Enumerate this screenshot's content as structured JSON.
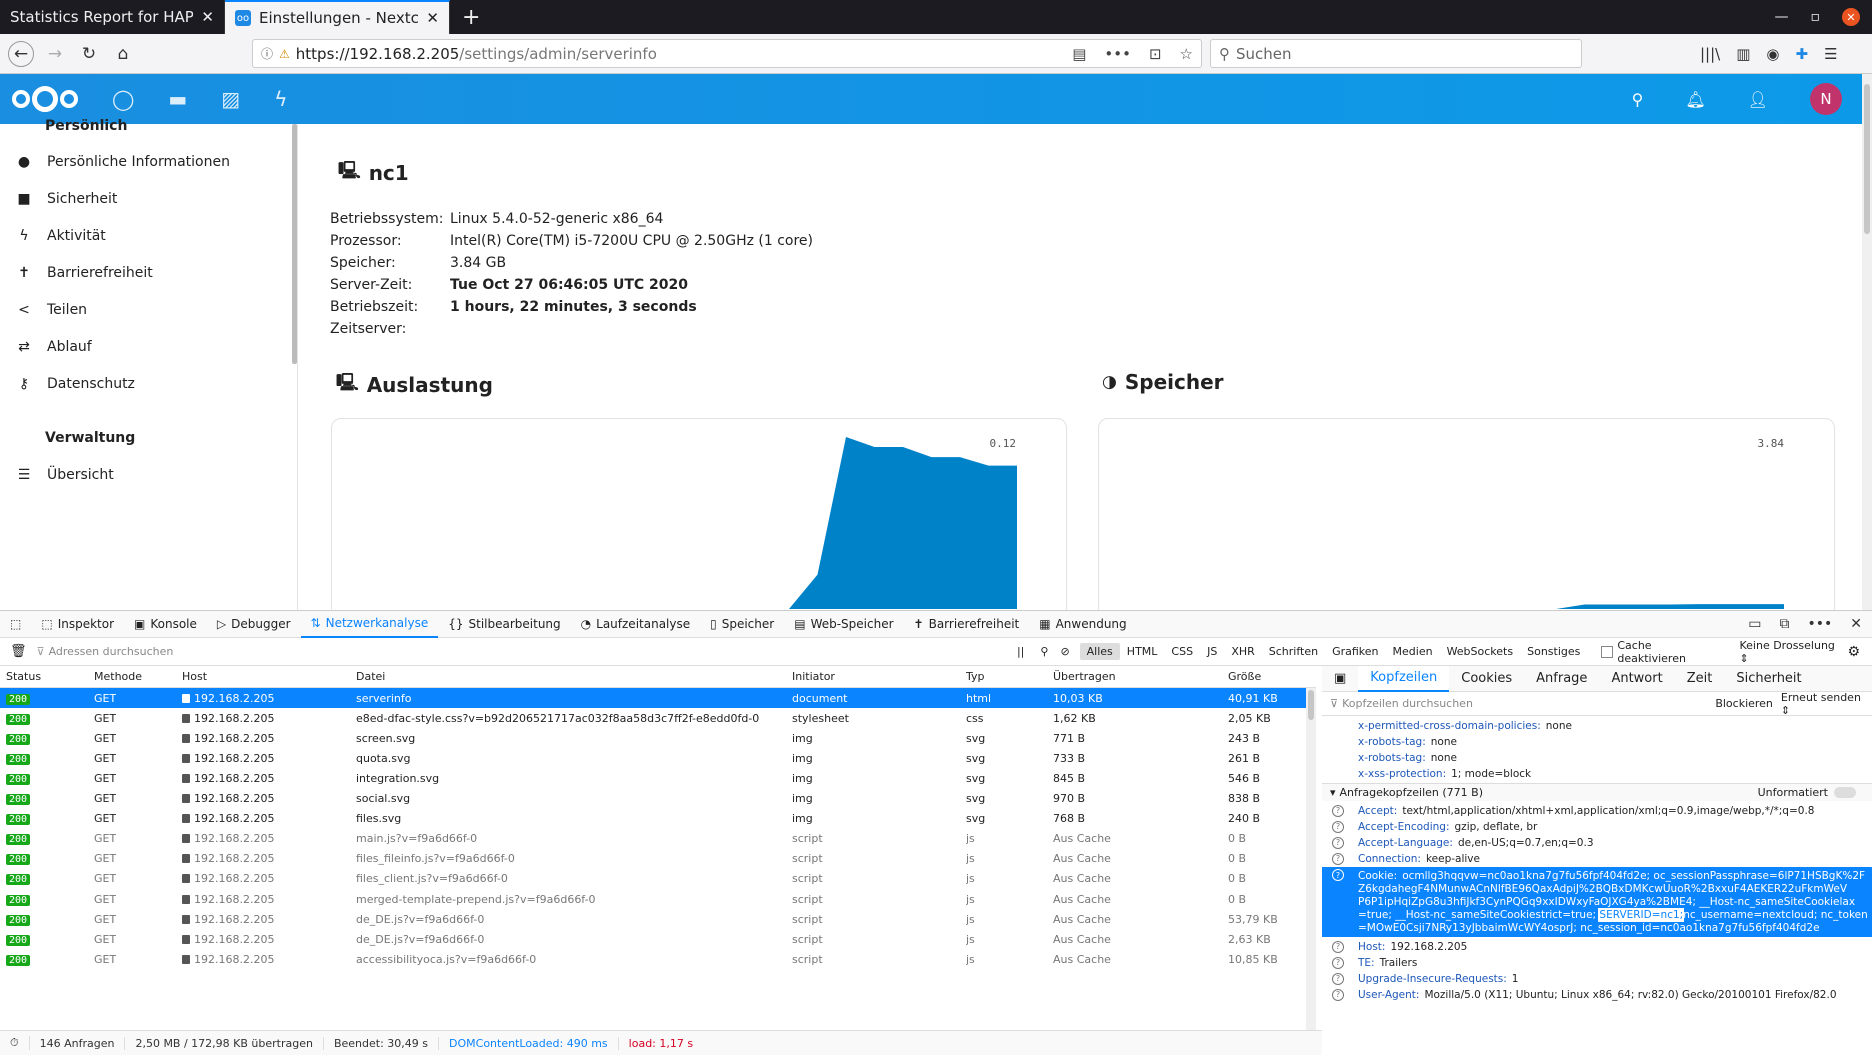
{
  "browser": {
    "tabs": [
      {
        "title": "Statistics Report for HAProx",
        "active": false
      },
      {
        "title": "Einstellungen - Nextclou",
        "active": true
      }
    ],
    "url_host": "https://192.168.2.205",
    "url_path": "/settings/admin/serverinfo",
    "search_placeholder": "Suchen"
  },
  "nextcloud": {
    "avatar_letter": "N",
    "brand_color": "#0082c9"
  },
  "sidebar": {
    "heading_personal": "Persönlich",
    "items": [
      "Persönliche Informationen",
      "Sicherheit",
      "Aktivität",
      "Barrierefreiheit",
      "Teilen",
      "Ablauf",
      "Datenschutz"
    ],
    "heading_admin": "Verwaltung",
    "admin_items": [
      "Übersicht"
    ]
  },
  "server": {
    "name": "nc1",
    "rows": [
      {
        "k": "Betriebssystem:",
        "v": "Linux 5.4.0-52-generic x86_64",
        "bold": false
      },
      {
        "k": "Prozessor:",
        "v": "Intel(R) Core(TM) i5-7200U CPU @ 2.50GHz (1 core)",
        "bold": false
      },
      {
        "k": "Speicher:",
        "v": "3.84 GB",
        "bold": false
      },
      {
        "k": "Server-Zeit:",
        "v": "Tue Oct 27 06:46:05 UTC 2020",
        "bold": true
      },
      {
        "k": "Betriebszeit:",
        "v": "1 hours, 22 minutes, 3 seconds",
        "bold": true
      },
      {
        "k": "Zeitserver:",
        "v": "",
        "bold": false
      }
    ],
    "load_title": "Auslastung",
    "mem_title": "Speicher",
    "load_max": "0.12",
    "mem_max": "3.84"
  },
  "chart_data": [
    {
      "type": "area",
      "title": "Auslastung",
      "max_label": "0.12",
      "series": [
        {
          "values": [
            0,
            0,
            0,
            0.024,
            0.12,
            0.113,
            0.113,
            0.106,
            0.106,
            0.1,
            0.1
          ]
        }
      ]
    },
    {
      "type": "area",
      "title": "Speicher",
      "max_label": "3.84",
      "series": [
        {
          "values": [
            0,
            0,
            0,
            0.1,
            0.1,
            0.1,
            0.1,
            0.11,
            0.11,
            0.11,
            0.11
          ]
        }
      ]
    }
  ],
  "devtools": {
    "tabs": [
      "Inspektor",
      "Konsole",
      "Debugger",
      "Netzwerkanalyse",
      "Stilbearbeitung",
      "Laufzeitanalyse",
      "Speicher",
      "Web-Speicher",
      "Barrierefreiheit",
      "Anwendung"
    ],
    "active_tab": "Netzwerkanalyse",
    "filter_placeholder": "Adressen durchsuchen",
    "type_filters": [
      "Alles",
      "HTML",
      "CSS",
      "JS",
      "XHR",
      "Schriften",
      "Grafiken",
      "Medien",
      "WebSockets",
      "Sonstiges"
    ],
    "cache_label": "Cache deaktivieren",
    "throttle": "Keine Drosselung ⇕",
    "columns": [
      "Status",
      "Methode",
      "Host",
      "Datei",
      "Initiator",
      "Typ",
      "Übertragen",
      "Größe"
    ],
    "requests": [
      [
        "200",
        "GET",
        "192.168.2.205",
        "serverinfo",
        "document",
        "html",
        "10,03 KB",
        "40,91 KB"
      ],
      [
        "200",
        "GET",
        "192.168.2.205",
        "e8ed-dfac-style.css?v=b92d206521717ac032f8aa58d3c7ff2f-e8edd0fd-0",
        "stylesheet",
        "css",
        "1,62 KB",
        "2,05 KB"
      ],
      [
        "200",
        "GET",
        "192.168.2.205",
        "screen.svg",
        "img",
        "svg",
        "771 B",
        "243 B"
      ],
      [
        "200",
        "GET",
        "192.168.2.205",
        "quota.svg",
        "img",
        "svg",
        "733 B",
        "261 B"
      ],
      [
        "200",
        "GET",
        "192.168.2.205",
        "integration.svg",
        "img",
        "svg",
        "845 B",
        "546 B"
      ],
      [
        "200",
        "GET",
        "192.168.2.205",
        "social.svg",
        "img",
        "svg",
        "970 B",
        "838 B"
      ],
      [
        "200",
        "GET",
        "192.168.2.205",
        "files.svg",
        "img",
        "svg",
        "768 B",
        "240 B"
      ],
      [
        "200",
        "GET",
        "192.168.2.205",
        "main.js?v=f9a6d66f-0",
        "script",
        "js",
        "Aus Cache",
        "0 B"
      ],
      [
        "200",
        "GET",
        "192.168.2.205",
        "files_fileinfo.js?v=f9a6d66f-0",
        "script",
        "js",
        "Aus Cache",
        "0 B"
      ],
      [
        "200",
        "GET",
        "192.168.2.205",
        "files_client.js?v=f9a6d66f-0",
        "script",
        "js",
        "Aus Cache",
        "0 B"
      ],
      [
        "200",
        "GET",
        "192.168.2.205",
        "merged-template-prepend.js?v=f9a6d66f-0",
        "script",
        "js",
        "Aus Cache",
        "0 B"
      ],
      [
        "200",
        "GET",
        "192.168.2.205",
        "de_DE.js?v=f9a6d66f-0",
        "script",
        "js",
        "Aus Cache",
        "53,79 KB"
      ],
      [
        "200",
        "GET",
        "192.168.2.205",
        "de_DE.js?v=f9a6d66f-0",
        "script",
        "js",
        "Aus Cache",
        "2,63 KB"
      ],
      [
        "200",
        "GET",
        "192.168.2.205",
        "accessibilityoca.js?v=f9a6d66f-0",
        "script",
        "js",
        "Aus Cache",
        "10,85 KB"
      ]
    ],
    "status": {
      "requests": "146 Anfragen",
      "transferred": "2,50 MB / 172,98 KB übertragen",
      "finished": "Beendet: 30,49 s",
      "dcl": "DOMContentLoaded: 490 ms",
      "load": "load: 1,17 s"
    },
    "detail_tabs": [
      "Kopfzeilen",
      "Cookies",
      "Anfrage",
      "Antwort",
      "Zeit",
      "Sicherheit"
    ],
    "detail_filter": "Kopfzeilen durchsuchen",
    "block_label": "Blockieren",
    "resend_label": "Erneut senden ⇕",
    "resp_headers": [
      {
        "n": "x-permitted-cross-domain-policies:",
        "v": "none"
      },
      {
        "n": "x-robots-tag:",
        "v": "none"
      },
      {
        "n": "x-robots-tag:",
        "v": "none"
      },
      {
        "n": "x-xss-protection:",
        "v": "1; mode=block"
      }
    ],
    "req_section": "Anfragekopfzeilen (771 B)",
    "raw_label": "Unformatiert",
    "req_headers": [
      {
        "n": "Accept:",
        "v": "text/html,application/xhtml+xml,application/xml;q=0.9,image/webp,*/*;q=0.8"
      },
      {
        "n": "Accept-Encoding:",
        "v": "gzip, deflate, br"
      },
      {
        "n": "Accept-Language:",
        "v": "de,en-US;q=0.7,en;q=0.3"
      },
      {
        "n": "Connection:",
        "v": "keep-alive"
      }
    ],
    "cookie_name": "Cookie:",
    "cookie_lines": [
      "ocmllg3hqqvw=nc0ao1kna7g7fu56fpf404fd2e; oc_sessionPassphrase=6lP71HSBgK%2F",
      "Z6kgdahegF4NMunwACnNlfBE96QaxAdpiJ%2BQBxDMKcwUuoR%2BxxuF4AEKER22uFkmWeV",
      "P6P1ipHqiZpG8u3hfiJkf3CynPQGq9xxIDWxyFaOJXG4ya%2BME4; __Host-nc_sameSiteCookielax",
      "=true; __Host-nc_sameSiteCookiestrict=true; ",
      "=MOwE0Csji7NRy13yJbbaimWcWY4osprJ; nc_session_id=nc0ao1kna7g7fu56fpf404fd2e"
    ],
    "cookie_highlight": "SERVERID=nc1;",
    "cookie_line4_rest": "nc_username=nextcloud; nc_token",
    "after_headers": [
      {
        "n": "Host:",
        "v": "192.168.2.205"
      },
      {
        "n": "TE:",
        "v": "Trailers"
      },
      {
        "n": "Upgrade-Insecure-Requests:",
        "v": "1"
      },
      {
        "n": "User-Agent:",
        "v": "Mozilla/5.0 (X11; Ubuntu; Linux x86_64; rv:82.0) Gecko/20100101 Firefox/82.0"
      }
    ]
  }
}
